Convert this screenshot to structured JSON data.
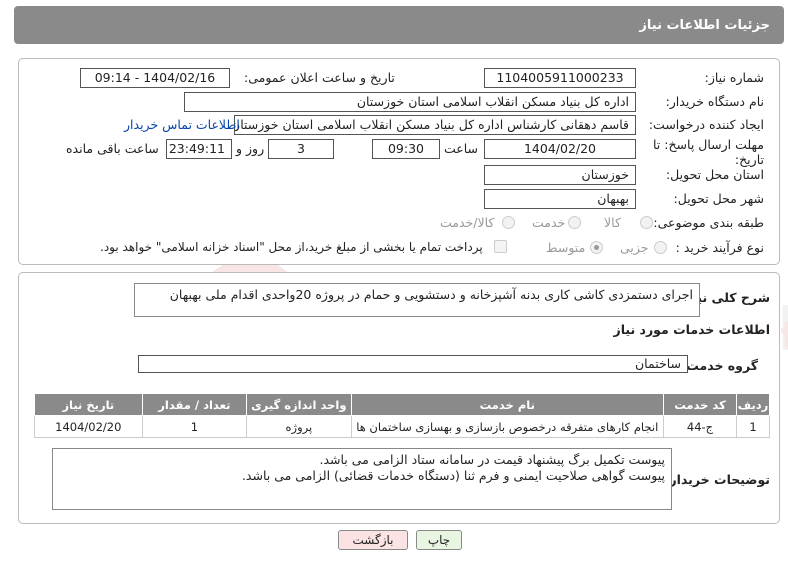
{
  "header": {
    "title": "جزئیات اطلاعات نیاز"
  },
  "form": {
    "need_number": {
      "label": "شماره نیاز:",
      "value": "1104005911000233"
    },
    "announce_datetime": {
      "label": "تاریخ و ساعت اعلان عمومی:",
      "value": "1404/02/16 - 09:14"
    },
    "buyer_org": {
      "label": "نام دستگاه خریدار:",
      "value": "اداره کل بنیاد مسکن انقلاب اسلامی استان خوزستان"
    },
    "requester": {
      "label": "ایجاد کننده درخواست:",
      "value": "قاسم دهقانی کارشناس اداره کل بنیاد مسکن انقلاب اسلامی استان خوزستان",
      "contact_link": "اطلاعات تماس خریدار"
    },
    "deadline": {
      "label_line1": "مهلت ارسال پاسخ: تا",
      "label_line2": "تاریخ:",
      "date": "1404/02/20",
      "time_label": "ساعت",
      "time": "09:30",
      "days": "3",
      "days_label": "روز و",
      "remaining": "23:49:11",
      "remaining_label": "ساعت باقی مانده"
    },
    "province": {
      "label": "استان محل تحویل:",
      "value": "خوزستان"
    },
    "city": {
      "label": "شهر محل تحویل:",
      "value": "بهبهان"
    },
    "category": {
      "label": "طبقه بندی موضوعی:",
      "options": [
        "کالا",
        "خدمت",
        "کالا/خدمت"
      ]
    },
    "purchase_type": {
      "label": "نوع فرآیند خرید :",
      "options": [
        "جزیی",
        "متوسط"
      ],
      "payment_note": "پرداخت تمام یا بخشی از مبلغ خرید،از محل \"اسناد خزانه اسلامی\" خواهد بود."
    }
  },
  "description": {
    "label": "شرح کلی نیاز:",
    "value": "اجرای دستمزدی کاشی کاری  بدنه آشپزخانه و دستشویی و حمام  در  پروژه 20واحدی اقدام ملی بهبهان"
  },
  "services": {
    "section_title": "اطلاعات خدمات مورد نیاز",
    "group_label": "گروه خدمت:",
    "group_value": "ساختمان",
    "columns": [
      "ردیف",
      "کد خدمت",
      "نام خدمت",
      "واحد اندازه گیری",
      "تعداد / مقدار",
      "تاریخ نیاز"
    ],
    "rows": [
      [
        "1",
        "ج-44",
        "انجام کارهای متفرقه درخصوص بازسازی و بهسازی ساختمان ها",
        "پروژه",
        "1",
        "1404/02/20"
      ]
    ]
  },
  "buyer_notes": {
    "label": "توضیحات خریدار:",
    "line1": "پیوست تکمیل برگ پیشنهاد قیمت در سامانه ستاد الزامی می باشد.",
    "line2": "پیوست گواهی صلاحیت ایمنی و فرم ثنا (دستگاه خدمات قضائی) الزامی می باشد."
  },
  "buttons": {
    "print": "چاپ",
    "back": "بازگشت"
  },
  "colors": {
    "header_bg": "#8a8a8a",
    "link": "#0645ad",
    "print_bg": "#e8f5e0",
    "back_bg": "#fbe3e3"
  }
}
